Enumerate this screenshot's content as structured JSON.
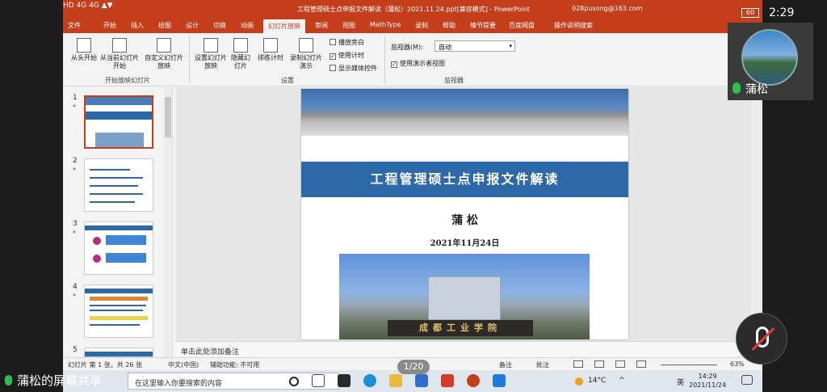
{
  "window_title": "工程管理硕士点申报文件解读（蒲松）2021.11.24.ppt[兼容模式] - PowerPoint",
  "account": "028pusong@163.com",
  "tabs": [
    "文件",
    "开始",
    "插入",
    "绘图",
    "设计",
    "切换",
    "动画",
    "幻灯片放映",
    "审阅",
    "视图",
    "MathType",
    "录制",
    "帮助",
    "情节提要",
    "百度网盘",
    "操作说明搜索"
  ],
  "active_tab": "幻灯片放映",
  "ribbon": {
    "from_start": "从头开始",
    "from_current": "从当前幻灯片开始",
    "custom": "自定义幻灯片放映",
    "group1": "开始放映幻灯片",
    "setup": "设置幻灯片放映",
    "hide": "隐藏幻灯片",
    "rehearse": "排练计时",
    "record": "录制幻灯片演示",
    "chk_narration": "播放旁白",
    "chk_timing": "使用计时",
    "chk_media": "显示媒体控件",
    "group2": "设置",
    "monitor_label": "监视器(M):",
    "monitor_value": "自动",
    "presenter_view": "使用演示者视图",
    "group3": "监视器"
  },
  "thumbs": [
    {
      "num": "1",
      "star": "*"
    },
    {
      "num": "2",
      "star": "*"
    },
    {
      "num": "3",
      "star": "*"
    },
    {
      "num": "4",
      "star": "*"
    },
    {
      "num": "5",
      "star": "*"
    }
  ],
  "slide": {
    "title": "工程管理硕士点申报文件解读",
    "presenter": "蒲 松",
    "date": "2021年11月24日",
    "gate_text": "成都工业学院"
  },
  "notes_placeholder": "单击此处添加备注",
  "status": {
    "slide_info": "幻灯片 第 1 张，共 26 张",
    "language": "中文(中国)",
    "accessibility": "辅助功能: 不可用",
    "notes": "备注",
    "comments": "批注",
    "zoom": "63%"
  },
  "taskbar": {
    "search_placeholder": "在这里输入你要搜索的内容",
    "weather": "14°C",
    "ime": "英",
    "time": "14:29",
    "date": "2021/11/24"
  },
  "phone": {
    "time": "2:29",
    "battery": "60",
    "participant": "蒲松",
    "pager": "1/20",
    "share_label": "蒲松的屏幕共享"
  },
  "colors": {
    "accent": "#c43e1c",
    "slide_blue": "#2d68a9",
    "mic_green": "#2fbf4f",
    "mute_red": "#e23a3a"
  }
}
